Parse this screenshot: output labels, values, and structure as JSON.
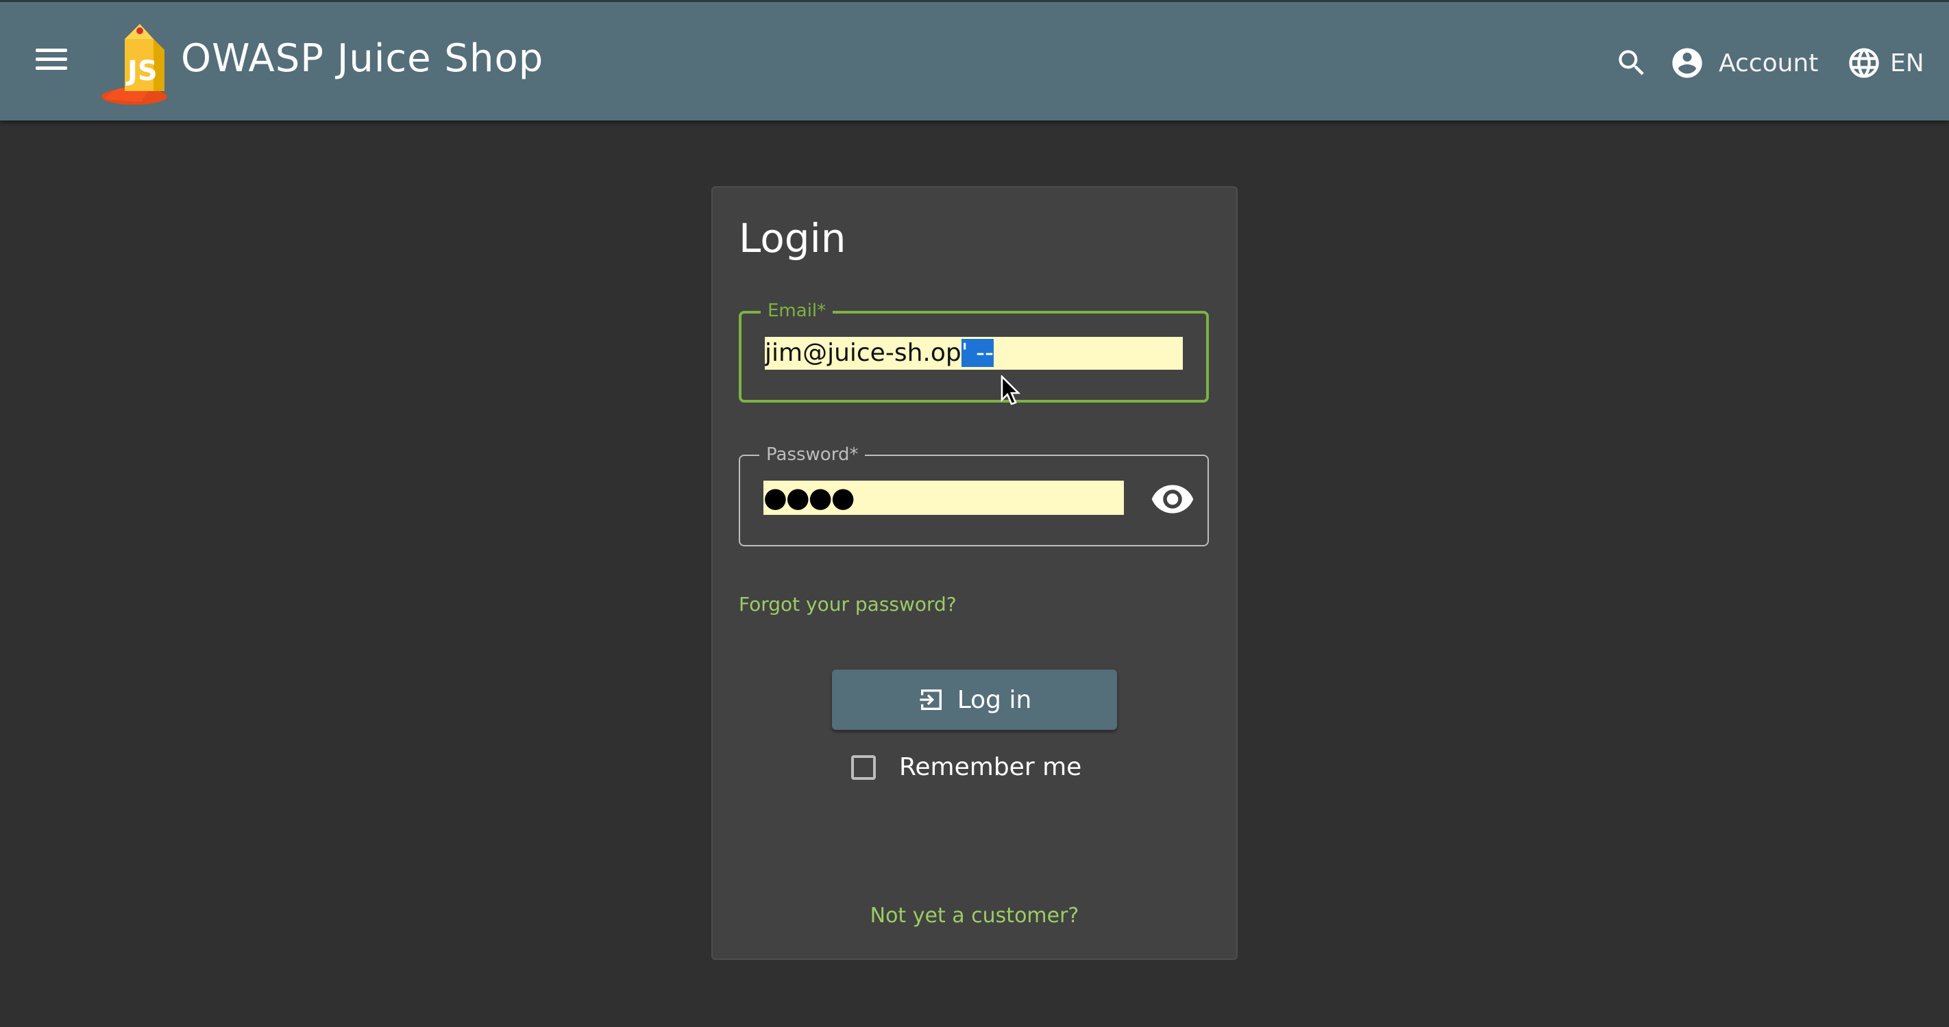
{
  "header": {
    "brand": "OWASP Juice Shop",
    "account_label": "Account",
    "language_label": "EN",
    "icons": [
      "menu-icon",
      "juice-shop-logo",
      "search-icon",
      "account-circle-icon",
      "language-globe-icon"
    ]
  },
  "login": {
    "title": "Login",
    "email": {
      "label": "Email*",
      "value_plain": "jim@juice-sh.op",
      "value_selected": "' --"
    },
    "password": {
      "label": "Password*",
      "value_masked": "●●●●",
      "toggle_icon": "eye-icon"
    },
    "forgot_link": "Forgot your password?",
    "login_button": "Log in",
    "login_icon": "login-arrow-icon",
    "remember_label": "Remember me",
    "remember_checked": false,
    "register_link": "Not yet a customer?"
  },
  "colors": {
    "toolbar": "#546e7a",
    "background": "#303030",
    "card": "#424242",
    "accent_green": "#7cb342",
    "link_green": "#9ccc65",
    "autofill": "#fff9c4",
    "selection": "#1e74d6"
  }
}
